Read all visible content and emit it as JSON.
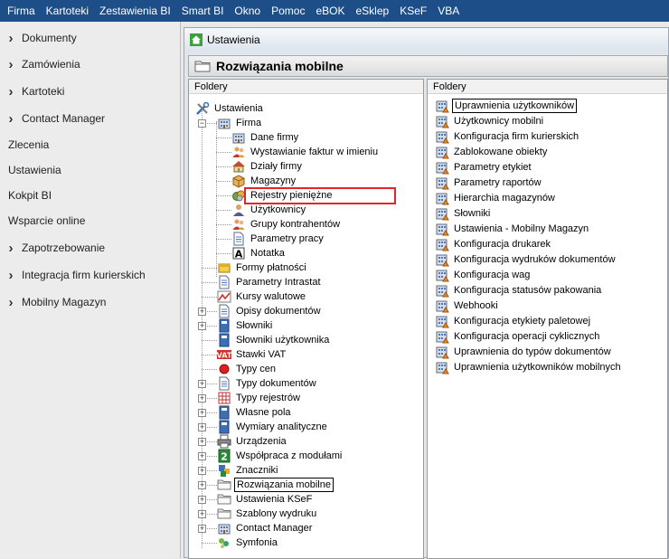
{
  "menu": [
    "Firma",
    "Kartoteki",
    "Zestawienia BI",
    "Smart BI",
    "Okno",
    "Pomoc",
    "eBOK",
    "eSklep",
    "KSeF",
    "VBA"
  ],
  "sidebar": [
    {
      "label": "Dokumenty",
      "chevron": true
    },
    {
      "label": "Zamówienia",
      "chevron": true
    },
    {
      "label": "Kartoteki",
      "chevron": true
    },
    {
      "label": "Contact Manager",
      "chevron": true
    },
    {
      "label": "Zlecenia",
      "chevron": false
    },
    {
      "label": "Ustawienia",
      "chevron": false
    },
    {
      "label": "Kokpit BI",
      "chevron": false
    },
    {
      "label": "Wsparcie online",
      "chevron": false
    },
    {
      "label": "Zapotrzebowanie",
      "chevron": true
    },
    {
      "label": "Integracja firm kurierskich",
      "chevron": true
    },
    {
      "label": "Mobilny Magazyn",
      "chevron": true
    }
  ],
  "window": {
    "title": "Ustawienia",
    "subheader": "Rozwiązania mobilne"
  },
  "left_pane": {
    "header": "Foldery",
    "tree": [
      {
        "label": "Ustawienia",
        "icon": "tools-icon",
        "level": 0,
        "expander": ""
      },
      {
        "label": "Firma",
        "icon": "building-icon",
        "level": 1,
        "expander": "−"
      },
      {
        "label": "Dane firmy",
        "icon": "building-icon",
        "level": 2,
        "expander": ""
      },
      {
        "label": "Wystawianie faktur w imieniu",
        "icon": "users-icon",
        "level": 2,
        "expander": ""
      },
      {
        "label": "Działy firmy",
        "icon": "house-icon",
        "level": 2,
        "expander": ""
      },
      {
        "label": "Magazyny",
        "icon": "box-icon",
        "level": 2,
        "expander": ""
      },
      {
        "label": "Rejestry pieniężne",
        "icon": "money-icon",
        "level": 2,
        "expander": ""
      },
      {
        "label": "Użytkownicy",
        "icon": "user-icon",
        "level": 2,
        "expander": ""
      },
      {
        "label": "Grupy kontrahentów",
        "icon": "users-icon",
        "level": 2,
        "expander": ""
      },
      {
        "label": "Parametry pracy",
        "icon": "document-icon",
        "level": 2,
        "expander": ""
      },
      {
        "label": "Notatka",
        "icon": "letter-a-icon",
        "level": 2,
        "expander": ""
      },
      {
        "label": "Formy płatności",
        "icon": "coins-icon",
        "level": 1,
        "expander": ""
      },
      {
        "label": "Parametry Intrastat",
        "icon": "document-icon",
        "level": 1,
        "expander": ""
      },
      {
        "label": "Kursy walutowe",
        "icon": "chart-icon",
        "level": 1,
        "expander": ""
      },
      {
        "label": "Opisy dokumentów",
        "icon": "document-icon",
        "level": 1,
        "expander": "+"
      },
      {
        "label": "Słowniki",
        "icon": "book-icon",
        "level": 1,
        "expander": "+"
      },
      {
        "label": "Słowniki użytkownika",
        "icon": "book-icon",
        "level": 1,
        "expander": ""
      },
      {
        "label": "Stawki VAT",
        "icon": "vat-icon",
        "level": 1,
        "expander": ""
      },
      {
        "label": "Typy cen",
        "icon": "red-dot-icon",
        "level": 1,
        "expander": ""
      },
      {
        "label": "Typy dokumentów",
        "icon": "document-icon",
        "level": 1,
        "expander": "+"
      },
      {
        "label": "Typy rejestrów",
        "icon": "grid-icon",
        "level": 1,
        "expander": "+"
      },
      {
        "label": "Własne pola",
        "icon": "book-icon",
        "level": 1,
        "expander": "+"
      },
      {
        "label": "Wymiary analityczne",
        "icon": "book-icon",
        "level": 1,
        "expander": "+"
      },
      {
        "label": "Urządzenia",
        "icon": "printer-icon",
        "level": 1,
        "expander": "+"
      },
      {
        "label": "Współpraca z modułami",
        "icon": "number-2-icon",
        "level": 1,
        "expander": "+"
      },
      {
        "label": "Znaczniki",
        "icon": "tags-icon",
        "level": 1,
        "expander": "+"
      },
      {
        "label": "Rozwiązania mobilne",
        "icon": "folder-icon",
        "level": 1,
        "expander": "+",
        "selected": true
      },
      {
        "label": "Ustawienia KSeF",
        "icon": "folder-icon",
        "level": 1,
        "expander": "+"
      },
      {
        "label": "Szablony wydruku",
        "icon": "folder-icon",
        "level": 1,
        "expander": "+"
      },
      {
        "label": "Contact Manager",
        "icon": "building-icon",
        "level": 1,
        "expander": "+"
      },
      {
        "label": "Symfonia",
        "icon": "symfonia-icon",
        "level": 1,
        "expander": ""
      }
    ]
  },
  "right_pane": {
    "header": "Foldery",
    "items": [
      {
        "label": "Uprawnienia użytkowników",
        "selected": true
      },
      {
        "label": "Użytkownicy mobilni"
      },
      {
        "label": "Konfiguracja firm kurierskich"
      },
      {
        "label": "Zablokowane obiekty"
      },
      {
        "label": "Parametry etykiet"
      },
      {
        "label": "Parametry raportów"
      },
      {
        "label": "Hierarchia magazynów",
        "highlighted": true
      },
      {
        "label": "Słowniki"
      },
      {
        "label": "Ustawienia - Mobilny Magazyn"
      },
      {
        "label": "Konfiguracja drukarek"
      },
      {
        "label": "Konfiguracja wydruków dokumentów"
      },
      {
        "label": "Konfiguracja wag"
      },
      {
        "label": "Konfiguracja statusów pakowania"
      },
      {
        "label": "Webhooki"
      },
      {
        "label": "Konfiguracja etykiety paletowej"
      },
      {
        "label": "Konfiguracja operacji cyklicznych"
      },
      {
        "label": "Uprawnienia do typów dokumentów"
      },
      {
        "label": "Uprawnienia użytkowników mobilnych"
      }
    ]
  },
  "colors": {
    "menubar": "#1e4e88",
    "highlight": "#e0262b"
  }
}
